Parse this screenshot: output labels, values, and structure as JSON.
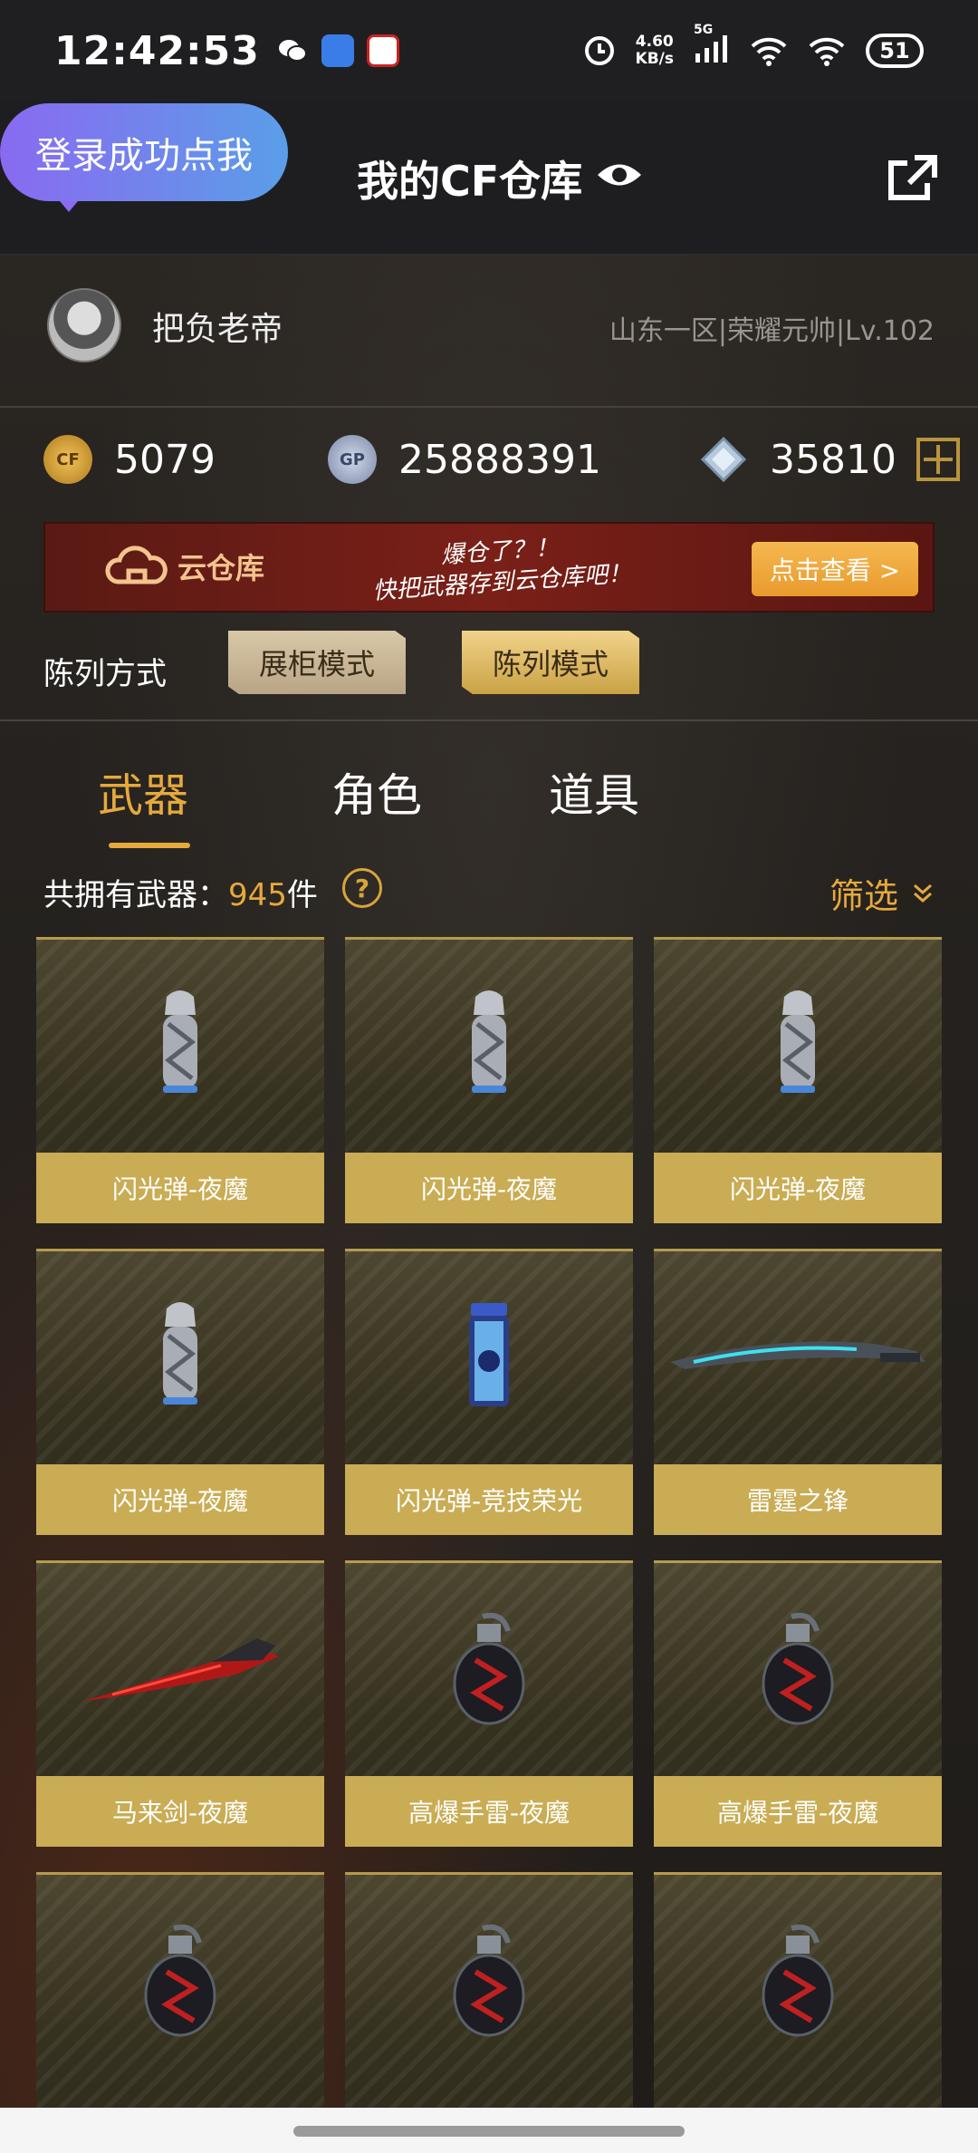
{
  "status_bar": {
    "time": "12:42:53",
    "net_speed_value": "4.60",
    "net_speed_unit": "KB/s",
    "signal_label": "5G",
    "battery": "51"
  },
  "header": {
    "login_bubble": "登录成功点我",
    "title": "我的CF仓库"
  },
  "profile": {
    "username": "把负老帝",
    "server_info": "山东一区|荣耀元帅|Lv.102"
  },
  "currency": {
    "cf_points": "5079",
    "gp": "25888391",
    "diamonds": "35810",
    "gp_icon_text": "GP"
  },
  "cloud_banner": {
    "name": "云仓库",
    "slogan_line1": "爆仓了？！",
    "slogan_line2": "快把武器存到云仓库吧！",
    "button": "点击查看 >"
  },
  "display_mode": {
    "label": "陈列方式",
    "showcase": "展柜模式",
    "list": "陈列模式"
  },
  "tabs": [
    {
      "label": "武器",
      "active": true
    },
    {
      "label": "角色",
      "active": false
    },
    {
      "label": "道具",
      "active": false
    }
  ],
  "count": {
    "prefix": "共拥有武器：",
    "value": "945",
    "suffix": "件",
    "help": "?"
  },
  "filter": {
    "label": "筛选"
  },
  "items": [
    {
      "name": "闪光弹-夜魔",
      "icon": "flashbang-nightmare-icon"
    },
    {
      "name": "闪光弹-夜魔",
      "icon": "flashbang-nightmare-icon"
    },
    {
      "name": "闪光弹-夜魔",
      "icon": "flashbang-nightmare-icon"
    },
    {
      "name": "闪光弹-夜魔",
      "icon": "flashbang-nightmare-icon"
    },
    {
      "name": "闪光弹-竞技荣光",
      "icon": "flashbang-glory-icon"
    },
    {
      "name": "雷霆之锋",
      "icon": "thunder-blade-icon"
    },
    {
      "name": "马来剑-夜魔",
      "icon": "kris-nightmare-icon"
    },
    {
      "name": "高爆手雷-夜魔",
      "icon": "grenade-nightmare-icon"
    },
    {
      "name": "高爆手雷-夜魔",
      "icon": "grenade-nightmare-icon"
    },
    {
      "name": "",
      "icon": "grenade-nightmare-icon"
    },
    {
      "name": "",
      "icon": "grenade-nightmare-icon"
    },
    {
      "name": "",
      "icon": "grenade-nightmare-icon"
    }
  ],
  "colors": {
    "accent_gold": "#e6a93c",
    "card_label": "#c9ac54",
    "banner_button": "#f5b851"
  }
}
